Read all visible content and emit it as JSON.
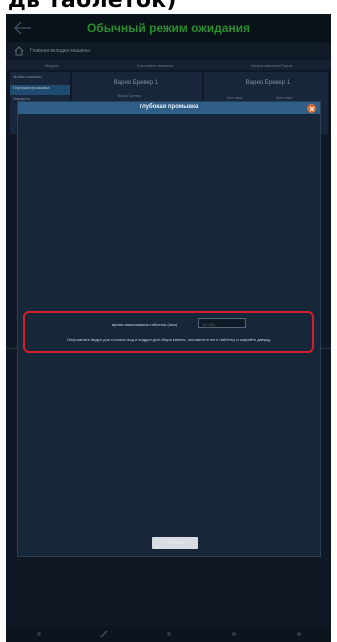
{
  "caption": {
    "text": "дь таблеток)"
  },
  "header": {
    "title": "Обычный режим ожидания"
  },
  "subbar": {
    "text": "Главная вкладка машины"
  },
  "columns": [
    "Модель",
    "Состояние машины",
    "Запуск машины/Пауза"
  ],
  "sidebar": {
    "items": [
      {
        "label": "Мойка машины",
        "active": false
      },
      {
        "label": "Глубокая промывка",
        "active": true
      },
      {
        "label": "Заварить",
        "active": false
      }
    ]
  },
  "background_panels": {
    "left_title": "Варио Бревер 1",
    "left_sub": "Варио Бревер",
    "right_title": "Варио Бревер 1",
    "right_sub": [
      "Заготовка",
      "Заготовка"
    ]
  },
  "modal": {
    "title": "глубокая промывка",
    "time_label": "время замачивания таблетки (мин)",
    "time_placeholder": "(1~25)",
    "instruction": "Опорожните ведро для сточных вод и поддон для сбора капель, положите в него таблетку и закройте дверцу.",
    "start_label": "Начать"
  },
  "colors": {
    "accent": "#2f5f88",
    "highlight": "#d2202a",
    "header_title": "#2a8f2e",
    "close": "#e0692a"
  },
  "icons": [
    "back-arrow-icon",
    "home-icon",
    "close-icon",
    "nav-icons"
  ]
}
